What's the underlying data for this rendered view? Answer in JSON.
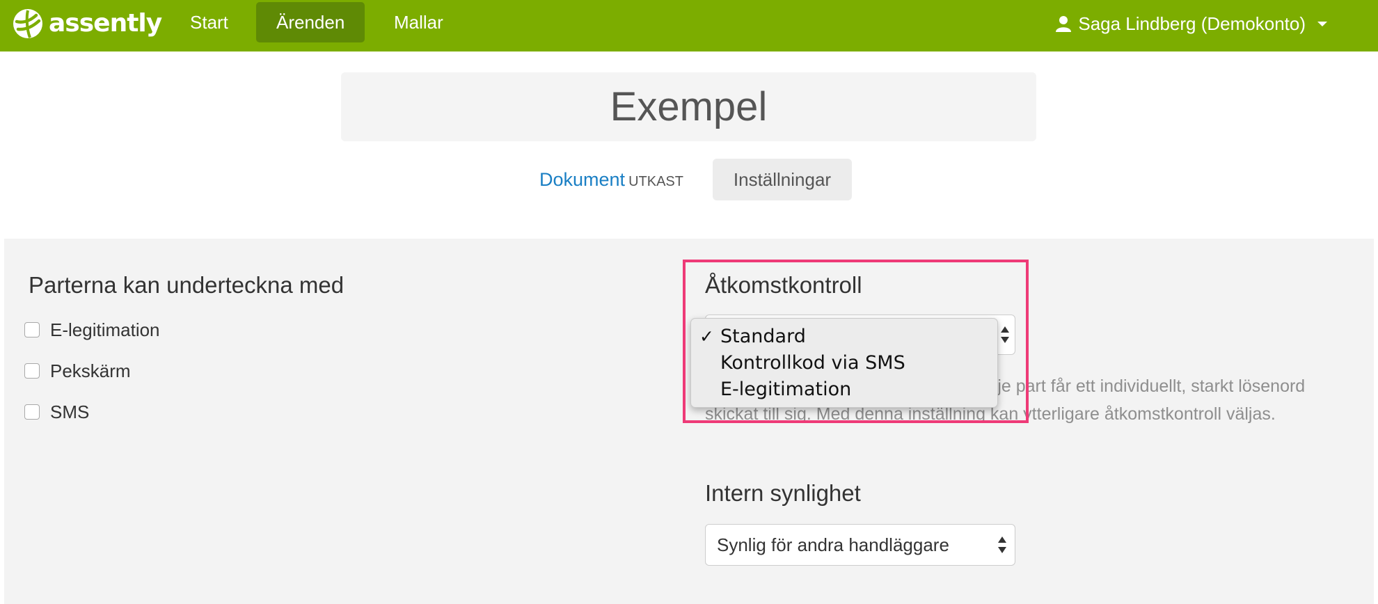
{
  "colors": {
    "navbar": "#7cad00",
    "navbar_active": "#5f8a05",
    "link": "#1a7fc4",
    "highlight": "#ee3a77",
    "panel": "#f3f3f3"
  },
  "navbar": {
    "logo_text": "assently",
    "logo_icon": "assently-logo-icon",
    "items": [
      {
        "label": "Start",
        "active": false
      },
      {
        "label": "Ärenden",
        "active": true
      },
      {
        "label": "Mallar",
        "active": false
      }
    ],
    "user": {
      "icon": "user-icon",
      "name": "Saga Lindberg (Demokonto)"
    }
  },
  "page": {
    "title": "Exempel",
    "tabs": {
      "document_label": "Dokument",
      "document_status": "UTKAST",
      "settings_label": "Inställningar"
    }
  },
  "signing": {
    "heading": "Parterna kan underteckna med",
    "options": [
      {
        "label": "E-legitimation",
        "checked": false
      },
      {
        "label": "Pekskärm",
        "checked": false
      },
      {
        "label": "SMS",
        "checked": false
      }
    ]
  },
  "access_control": {
    "heading": "Åtkomstkontroll",
    "selected": "Standard",
    "options": [
      "Standard",
      "Kontrollkod via SMS",
      "E-legitimation"
    ],
    "help_visible": "n att varje part får ett individuellt, starkt lösenord skickat till sig. Med denna inställning kan ytterligare åtkomstkontroll väljas."
  },
  "internal_visibility": {
    "heading": "Intern synlighet",
    "selected": "Synlig för andra handläggare"
  }
}
